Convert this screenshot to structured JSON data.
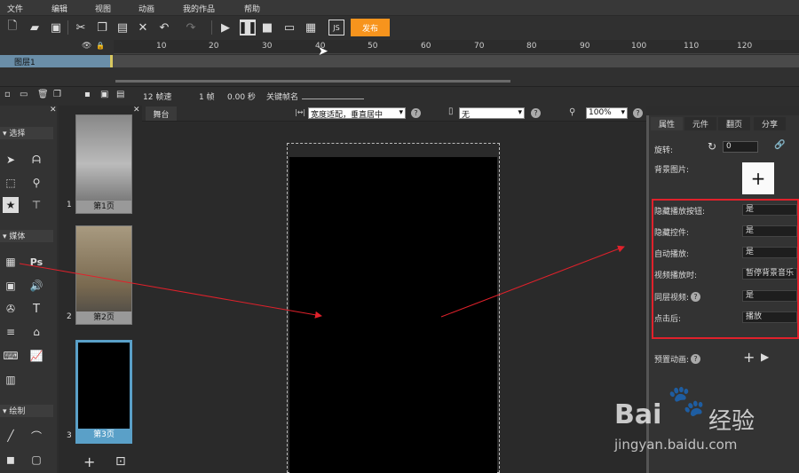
{
  "menu": [
    "文件",
    "编辑",
    "视图",
    "动画",
    "我的作品",
    "帮助"
  ],
  "toolbar": {
    "publish_label": "发布"
  },
  "timeline": {
    "ruler_ticks": [
      "10",
      "20",
      "30",
      "40",
      "50",
      "60",
      "70",
      "80",
      "90",
      "100",
      "110",
      "120"
    ],
    "layer_name": "图层1"
  },
  "framebar": {
    "fps": "12 帧速",
    "frame": "1 帧",
    "time": "0.00 秒",
    "keyframe_label": "关键帧名"
  },
  "left_sections": {
    "select": "选择",
    "media": "媒体",
    "draw": "绘制"
  },
  "pages": [
    {
      "num": "1",
      "label": "第1页"
    },
    {
      "num": "2",
      "label": "第2页"
    },
    {
      "num": "3",
      "label": "第3页"
    }
  ],
  "stage": {
    "tab": "舞台",
    "fit_mode": "宽度适配，垂直居中",
    "device": "无",
    "zoom": "100%"
  },
  "right_tabs": [
    "属性",
    "元件",
    "翻页",
    "分享"
  ],
  "props": {
    "rotate_label": "旋转:",
    "rotate_value": "0",
    "bg_label": "背景图片:",
    "rows": [
      {
        "label": "隐藏播放按钮:",
        "value": "是"
      },
      {
        "label": "隐藏控件:",
        "value": "是"
      },
      {
        "label": "自动播放:",
        "value": "是"
      },
      {
        "label": "视频播放时:",
        "value": "暂停背景音乐"
      },
      {
        "label": "同层视频:",
        "value": "是"
      },
      {
        "label": "点击后:",
        "value": "播放"
      }
    ],
    "preview_label": "预置动画:"
  },
  "watermark": {
    "brand": "Bai",
    "brand2": "经验",
    "url": "jingyan.baidu.com"
  },
  "colors": {
    "accent": "#f7941d",
    "highlight": "#e0212b",
    "layer": "#6a8ea8"
  }
}
